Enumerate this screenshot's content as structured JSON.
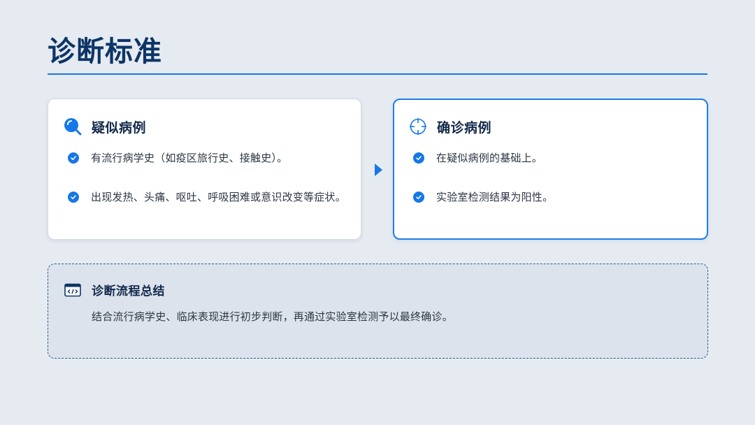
{
  "page": {
    "title": "诊断标准"
  },
  "colors": {
    "accent": "#1677e6",
    "title": "#0d3566",
    "background": "#e6ebf2"
  },
  "suspected": {
    "icon": "search-icon",
    "title": "疑似病例",
    "items": [
      "有流行病学史（如疫区旅行史、接触史）。",
      "出现发热、头痛、呕吐、呼吸困难或意识改变等症状。"
    ]
  },
  "flow": {
    "icon": "arrow-right-icon"
  },
  "confirmed": {
    "icon": "crosshair-icon",
    "title": "确诊病例",
    "items": [
      "在疑似病例的基础上。",
      "实验室检测结果为阳性。"
    ]
  },
  "summary": {
    "icon": "code-window-icon",
    "title": "诊断流程总结",
    "text": "结合流行病学史、临床表现进行初步判断，再通过实验室检测予以最终确诊。"
  }
}
